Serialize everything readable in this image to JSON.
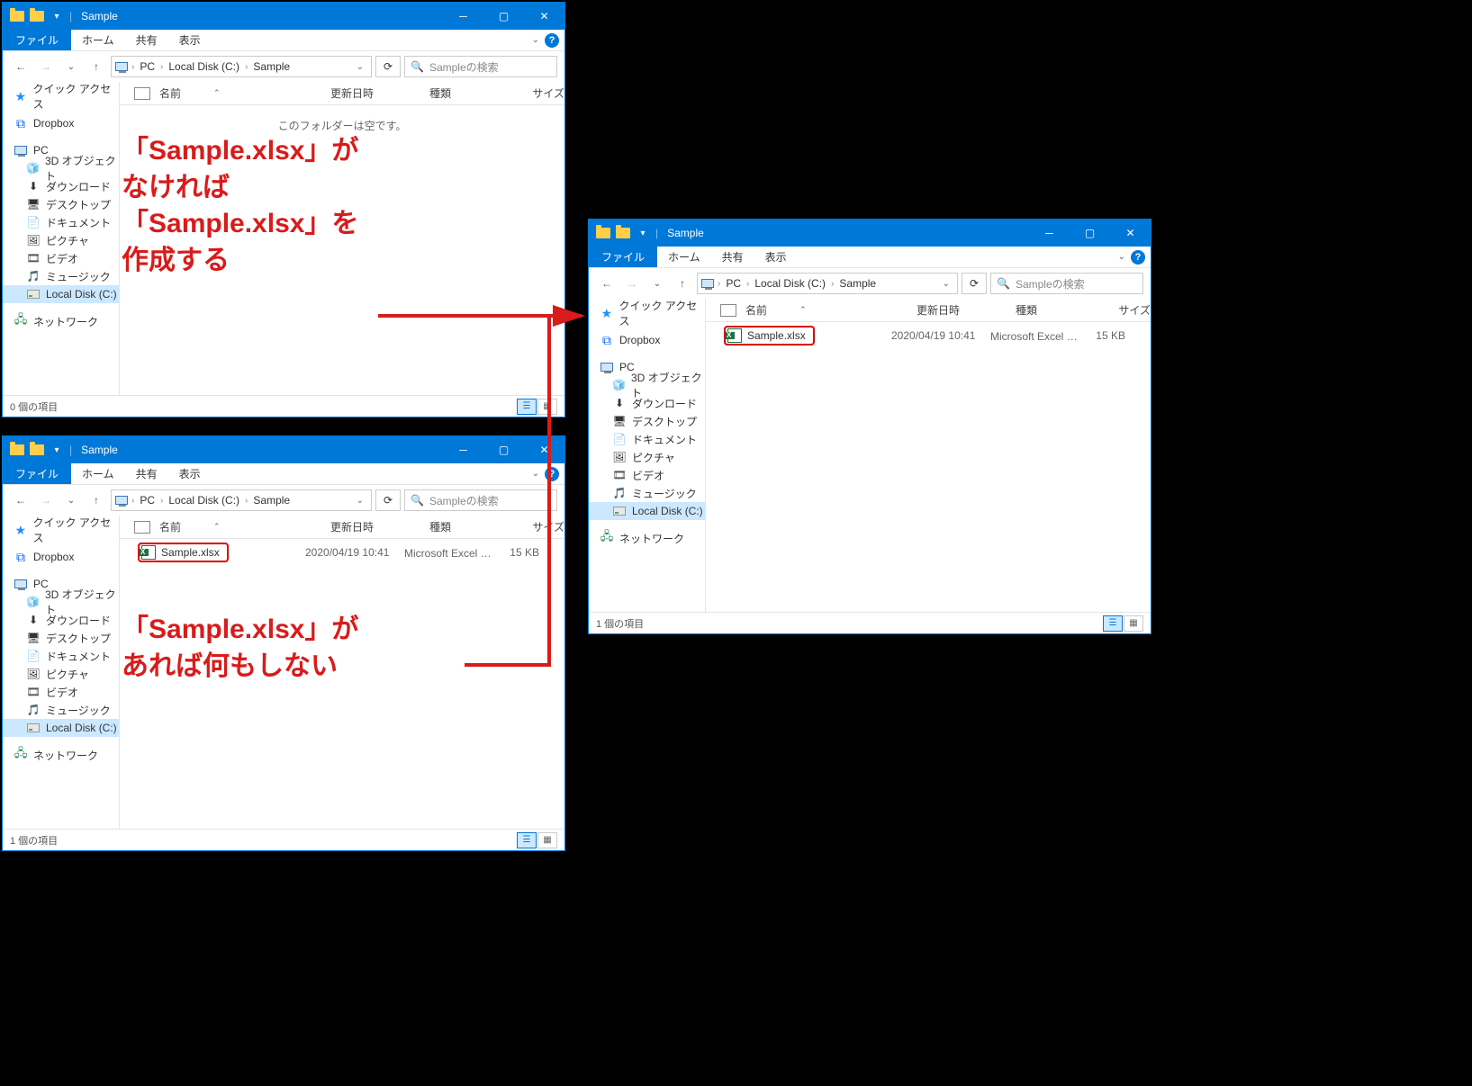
{
  "shared": {
    "title": "Sample",
    "tabs": {
      "file": "ファイル",
      "home": "ホーム",
      "share": "共有",
      "view": "表示"
    },
    "breadcrumb": [
      "PC",
      "Local Disk (C:)",
      "Sample"
    ],
    "search_placeholder": "Sampleの検索",
    "columns": {
      "name": "名前",
      "date": "更新日時",
      "type": "種類",
      "size": "サイズ"
    },
    "sidebar": {
      "quick": "クイック アクセス",
      "dropbox": "Dropbox",
      "pc": "PC",
      "pc_children": [
        "3D オブジェクト",
        "ダウンロード",
        "デスクトップ",
        "ドキュメント",
        "ピクチャ",
        "ビデオ",
        "ミュージック",
        "Local Disk (C:)"
      ],
      "network": "ネットワーク"
    }
  },
  "win1": {
    "empty_msg": "このフォルダーは空です。",
    "status": "0 個の項目"
  },
  "win2": {
    "file": {
      "name": "Sample.xlsx",
      "date": "2020/04/19 10:41",
      "type": "Microsoft Excel ワ...",
      "size": "15 KB"
    },
    "status": "1 個の項目"
  },
  "win3": {
    "file": {
      "name": "Sample.xlsx",
      "date": "2020/04/19 10:41",
      "type": "Microsoft Excel ワ...",
      "size": "15 KB"
    },
    "status": "1 個の項目"
  },
  "annot1": "「Sample.xlsx」が\nなければ\n「Sample.xlsx」を\n作成する",
  "annot2": "「Sample.xlsx」が\nあれば何もしない"
}
